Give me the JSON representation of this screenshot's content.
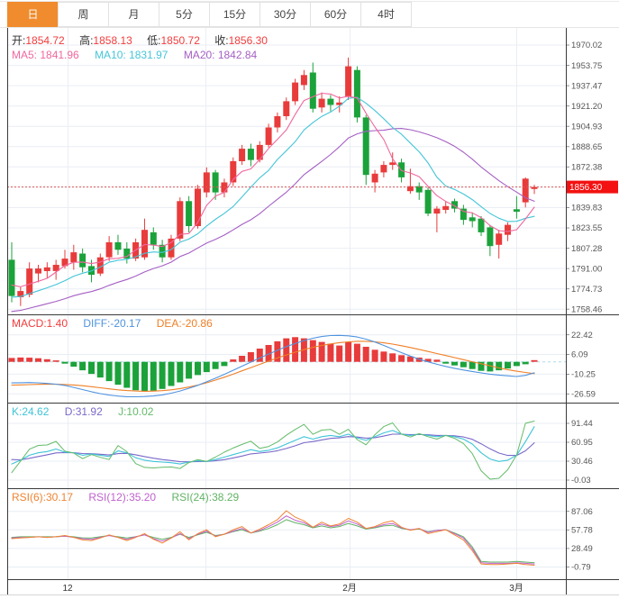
{
  "tabs": {
    "items": [
      {
        "label": "日",
        "selected": true
      },
      {
        "label": "周",
        "selected": false
      },
      {
        "label": "月",
        "selected": false
      },
      {
        "label": "5分",
        "selected": false
      },
      {
        "label": "15分",
        "selected": false
      },
      {
        "label": "30分",
        "selected": false
      },
      {
        "label": "60分",
        "selected": false
      },
      {
        "label": "4时",
        "selected": false
      }
    ]
  },
  "legends": {
    "ohlc": [
      {
        "label": "开:",
        "value": "1854.72"
      },
      {
        "label": "高:",
        "value": "1858.13"
      },
      {
        "label": "低:",
        "value": "1850.72"
      },
      {
        "label": "收:",
        "value": "1856.30"
      }
    ],
    "ma": [
      "MA5: 1841.96",
      "MA10: 1831.97",
      "MA20: 1842.84"
    ],
    "macd": [
      "MACD:1.40",
      "DIFF:-20.17",
      "DEA:-20.86"
    ],
    "kdj": [
      "K:24.62",
      "D:31.92",
      "J:10.02"
    ],
    "rsi": [
      "RSI(6):30.17",
      "RSI(12):35.20",
      "RSI(24):38.29"
    ]
  },
  "price_marker": {
    "text": "1856.30"
  },
  "xaxis": {
    "labels": [
      {
        "text": "12",
        "x": 75
      },
      {
        "text": "2月",
        "x": 388
      },
      {
        "text": "3月",
        "x": 573
      }
    ],
    "gridlines": [
      75,
      228,
      388,
      573
    ]
  },
  "colors": {
    "up": "#e83b3b",
    "down": "#1ba23a",
    "ma5": "#f0679e",
    "ma10": "#45c5d8",
    "ma20": "#a55fc4",
    "diff": "#4f93e0",
    "dea": "#ef7f26",
    "k": "#3fc4d8",
    "d": "#7a68c9",
    "j": "#63bb69",
    "rsi6": "#ef8432",
    "rsi12": "#bf62ce",
    "rsi24": "#61b364",
    "legend_red": "#f23c3c",
    "legend_label": "#333333",
    "marker_bg": "#f31111",
    "dotted_line": "#e05555",
    "grid": "#e9eef4",
    "frame": "#3a3a3a",
    "axis_text": "#555555",
    "tab_active_bg": "#f08c2d",
    "zero_dash": "#aadcee"
  },
  "chart_data": [
    {
      "type": "candlestick",
      "title": "daily gold price candlestick with MA5/MA10/MA20",
      "price_line": 1856.3,
      "y_axis_labels": [
        "1970.02",
        "1953.75",
        "1937.47",
        "1921.20",
        "1904.93",
        "1888.65",
        "1872.38",
        "1856.30",
        "1839.83",
        "1823.55",
        "1807.28",
        "1791.00",
        "1774.73",
        "1758.46"
      ],
      "ylim": [
        1758.46,
        1970.02
      ],
      "ma_periods": [
        5,
        10,
        20
      ],
      "ma_seeds": [
        1780,
        1768,
        1756
      ],
      "ohlc": [
        [
          1798,
          1812,
          1764,
          1769
        ],
        [
          1768,
          1776,
          1761,
          1773
        ],
        [
          1770,
          1796,
          1768,
          1791
        ],
        [
          1787,
          1794,
          1780,
          1791
        ],
        [
          1789,
          1796,
          1783,
          1792
        ],
        [
          1789,
          1798,
          1782,
          1794
        ],
        [
          1793,
          1806,
          1791,
          1799
        ],
        [
          1796,
          1810,
          1790,
          1804
        ],
        [
          1803,
          1807,
          1788,
          1792
        ],
        [
          1793,
          1798,
          1780,
          1786
        ],
        [
          1787,
          1803,
          1785,
          1800
        ],
        [
          1800,
          1817,
          1797,
          1812
        ],
        [
          1812,
          1818,
          1802,
          1806
        ],
        [
          1807,
          1812,
          1795,
          1799
        ],
        [
          1799,
          1815,
          1797,
          1812
        ],
        [
          1800,
          1831,
          1798,
          1822
        ],
        [
          1820,
          1824,
          1806,
          1810
        ],
        [
          1810,
          1814,
          1796,
          1800
        ],
        [
          1800,
          1818,
          1798,
          1815
        ],
        [
          1815,
          1848,
          1813,
          1845
        ],
        [
          1845,
          1849,
          1820,
          1825
        ],
        [
          1825,
          1858,
          1823,
          1855
        ],
        [
          1852,
          1872,
          1848,
          1868
        ],
        [
          1868,
          1870,
          1846,
          1852
        ],
        [
          1852,
          1863,
          1848,
          1860
        ],
        [
          1860,
          1880,
          1857,
          1877
        ],
        [
          1877,
          1890,
          1874,
          1887
        ],
        [
          1887,
          1891,
          1873,
          1878
        ],
        [
          1878,
          1893,
          1876,
          1890
        ],
        [
          1890,
          1907,
          1888,
          1904
        ],
        [
          1904,
          1916,
          1900,
          1913
        ],
        [
          1913,
          1928,
          1910,
          1925
        ],
        [
          1925,
          1943,
          1922,
          1940
        ],
        [
          1938,
          1950,
          1934,
          1946
        ],
        [
          1948,
          1956,
          1916,
          1919
        ],
        [
          1920,
          1932,
          1916,
          1927
        ],
        [
          1927,
          1930,
          1917,
          1922
        ],
        [
          1922,
          1929,
          1916,
          1924
        ],
        [
          1929,
          1960,
          1926,
          1953
        ],
        [
          1950,
          1953,
          1908,
          1912
        ],
        [
          1912,
          1914,
          1858,
          1866
        ],
        [
          1860,
          1870,
          1852,
          1867
        ],
        [
          1868,
          1877,
          1864,
          1874
        ],
        [
          1874,
          1884,
          1870,
          1876
        ],
        [
          1876,
          1879,
          1860,
          1864
        ],
        [
          1853,
          1871,
          1851,
          1857
        ],
        [
          1857,
          1860,
          1846,
          1852
        ],
        [
          1854,
          1856,
          1833,
          1835
        ],
        [
          1835,
          1841,
          1820,
          1839
        ],
        [
          1838,
          1845,
          1835,
          1841
        ],
        [
          1845,
          1847,
          1836,
          1839
        ],
        [
          1839,
          1842,
          1826,
          1830
        ],
        [
          1832,
          1836,
          1824,
          1829
        ],
        [
          1831,
          1833,
          1817,
          1820
        ],
        [
          1824,
          1826,
          1801,
          1809
        ],
        [
          1810,
          1822,
          1799,
          1819
        ],
        [
          1818,
          1828,
          1813,
          1826
        ],
        [
          1838.5,
          1849,
          1831,
          1836.5
        ],
        [
          1844,
          1864,
          1840,
          1863
        ],
        [
          1854.72,
          1858.13,
          1850.72,
          1856.3
        ]
      ]
    },
    {
      "type": "bar",
      "name": "MACD",
      "y_axis_labels": [
        "22.42",
        "6.09",
        "-10.25",
        "-26.59"
      ],
      "hist": [
        3.2,
        3.6,
        3.4,
        3.0,
        2.2,
        1.2,
        -1.5,
        -4.0,
        -7.0,
        -10.0,
        -13.0,
        -16.0,
        -19.0,
        -21.5,
        -23.5,
        -24.5,
        -24.0,
        -22.5,
        -20.0,
        -17.0,
        -14.0,
        -11.0,
        -8.5,
        -6.0,
        -3.5,
        2.0,
        5.0,
        8.0,
        11.0,
        14.0,
        17.0,
        19.5,
        20.5,
        19.5,
        18.0,
        16.5,
        15.0,
        13.5,
        16.5,
        15.0,
        12.5,
        10.0,
        8.5,
        7.0,
        5.5,
        4.5,
        3.5,
        2.5,
        1.8,
        -1.5,
        -3.0,
        -4.5,
        -6.0,
        -7.5,
        -8.0,
        -7.0,
        -5.5,
        -3.5,
        -2.0,
        1.4
      ],
      "series": [
        {
          "name": "DIFF",
          "values": [
            -17.5,
            -17.3,
            -17.2,
            -17.4,
            -17.9,
            -18.5,
            -19.6,
            -21.2,
            -23.0,
            -24.8,
            -26.4,
            -27.6,
            -28.4,
            -28.9,
            -29.0,
            -28.8,
            -28.3,
            -27.4,
            -26.0,
            -24.2,
            -22.0,
            -19.5,
            -16.6,
            -13.6,
            -10.4,
            -7.0,
            -3.6,
            -0.2,
            3.2,
            6.4,
            9.6,
            12.6,
            15.2,
            17.6,
            19.6,
            21.0,
            21.8,
            22.0,
            21.6,
            20.6,
            18.8,
            16.4,
            13.6,
            10.6,
            7.6,
            4.8,
            2.2,
            0.0,
            -2.0,
            -3.8,
            -5.4,
            -6.8,
            -8.0,
            -9.2,
            -10.2,
            -11.0,
            -11.6,
            -12.2,
            -11.2,
            -9.1
          ]
        },
        {
          "name": "DEA",
          "values": [
            -19.3,
            -19.1,
            -18.9,
            -18.7,
            -18.6,
            -18.6,
            -18.8,
            -19.2,
            -19.8,
            -20.6,
            -21.5,
            -22.4,
            -23.2,
            -23.8,
            -24.2,
            -24.4,
            -24.3,
            -23.9,
            -23.2,
            -22.2,
            -20.9,
            -19.3,
            -17.4,
            -15.2,
            -12.8,
            -10.2,
            -7.5,
            -4.8,
            -2.1,
            0.6,
            3.2,
            5.7,
            8.0,
            10.1,
            12.0,
            13.6,
            14.9,
            15.9,
            16.6,
            17.0,
            17.0,
            16.6,
            15.8,
            14.7,
            13.4,
            11.9,
            10.3,
            8.6,
            6.9,
            5.2,
            3.5,
            1.8,
            0.1,
            -1.6,
            -3.3,
            -5.0,
            -6.5,
            -7.8,
            -8.8,
            -9.8
          ]
        }
      ]
    },
    {
      "type": "line",
      "name": "KDJ",
      "y_axis_labels": [
        "91.44",
        "60.95",
        "30.46",
        "-0.03"
      ],
      "k": [
        26,
        32,
        40,
        44,
        46,
        50,
        45,
        44,
        40,
        42,
        40,
        38,
        47,
        44,
        36,
        32,
        30,
        29,
        28,
        26,
        29,
        31,
        30,
        33,
        37,
        41,
        45,
        49,
        46,
        48,
        52,
        58,
        64,
        70,
        66,
        70,
        72,
        70,
        74,
        68,
        64,
        70,
        76,
        80,
        74,
        72,
        74,
        72,
        70,
        72,
        70,
        66,
        58,
        44,
        34,
        30,
        32,
        40,
        62,
        86
      ],
      "d_seed": 33,
      "j_clamp": [
        -1,
        95
      ]
    },
    {
      "type": "line",
      "name": "RSI",
      "y_axis_labels": [
        "87.06",
        "57.78",
        "28.49",
        "-0.79"
      ],
      "series": [
        {
          "name": "RSI6",
          "values": [
            44,
            45,
            46,
            47,
            46,
            47,
            49,
            46,
            42,
            41,
            45,
            50,
            46,
            41,
            46,
            52,
            43,
            37,
            45,
            55,
            42,
            52,
            58,
            47,
            51,
            58,
            63,
            53,
            59,
            66,
            74,
            88,
            78,
            72,
            62,
            70,
            64,
            67,
            76,
            70,
            60,
            63,
            69,
            72,
            62,
            57,
            60,
            52,
            55,
            58,
            50,
            42,
            25,
            4,
            3,
            3,
            4,
            5,
            3,
            2
          ]
        },
        {
          "name": "RSI12",
          "values": [
            45,
            46,
            46,
            47,
            46,
            47,
            48,
            46,
            44,
            43,
            46,
            49,
            46,
            43,
            47,
            50,
            44,
            40,
            45,
            52,
            44,
            51,
            56,
            48,
            51,
            56,
            60,
            53,
            57,
            63,
            70,
            80,
            73,
            69,
            62,
            67,
            63,
            65,
            72,
            67,
            60,
            62,
            66,
            68,
            61,
            58,
            60,
            54,
            57,
            58,
            52,
            45,
            28,
            6,
            5,
            5,
            5,
            6,
            5,
            4
          ]
        },
        {
          "name": "RSI24",
          "values": [
            46,
            47,
            47,
            47,
            47,
            47,
            48,
            47,
            45,
            45,
            47,
            49,
            47,
            45,
            47,
            50,
            46,
            43,
            46,
            51,
            46,
            50,
            54,
            49,
            51,
            55,
            58,
            53,
            56,
            60,
            66,
            74,
            69,
            66,
            61,
            64,
            61,
            63,
            68,
            64,
            59,
            61,
            64,
            65,
            60,
            58,
            59,
            55,
            57,
            58,
            53,
            47,
            31,
            8,
            7,
            7,
            7,
            8,
            7,
            6
          ]
        }
      ]
    }
  ]
}
